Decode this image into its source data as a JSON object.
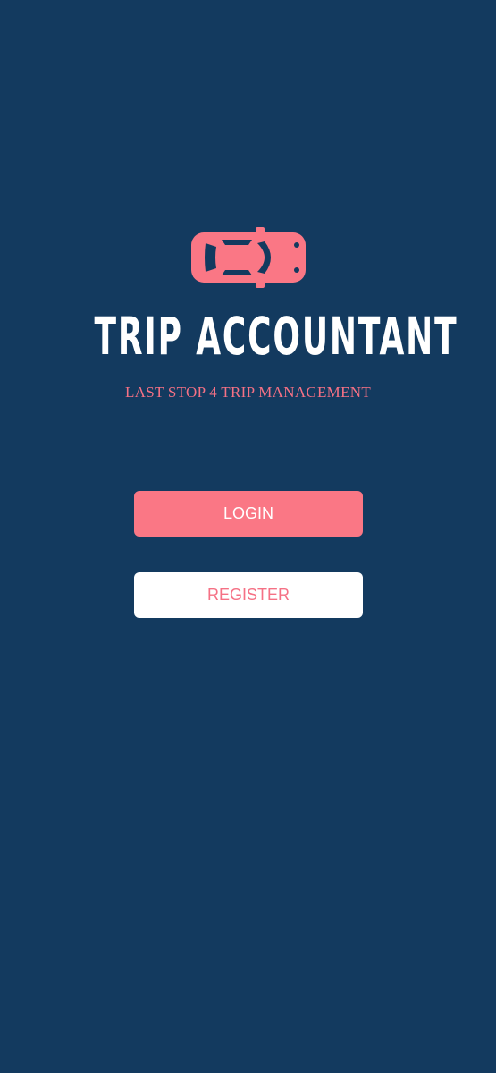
{
  "app": {
    "title": "TRIP ACCOUNTANT",
    "tagline": "LAST STOP 4 TRIP MANAGEMENT",
    "logo_icon": "car-icon"
  },
  "actions": {
    "login_label": "LOGIN",
    "register_label": "REGISTER"
  },
  "colors": {
    "background": "#133a5f",
    "accent": "#fa7785",
    "text_light": "#ffffff"
  }
}
